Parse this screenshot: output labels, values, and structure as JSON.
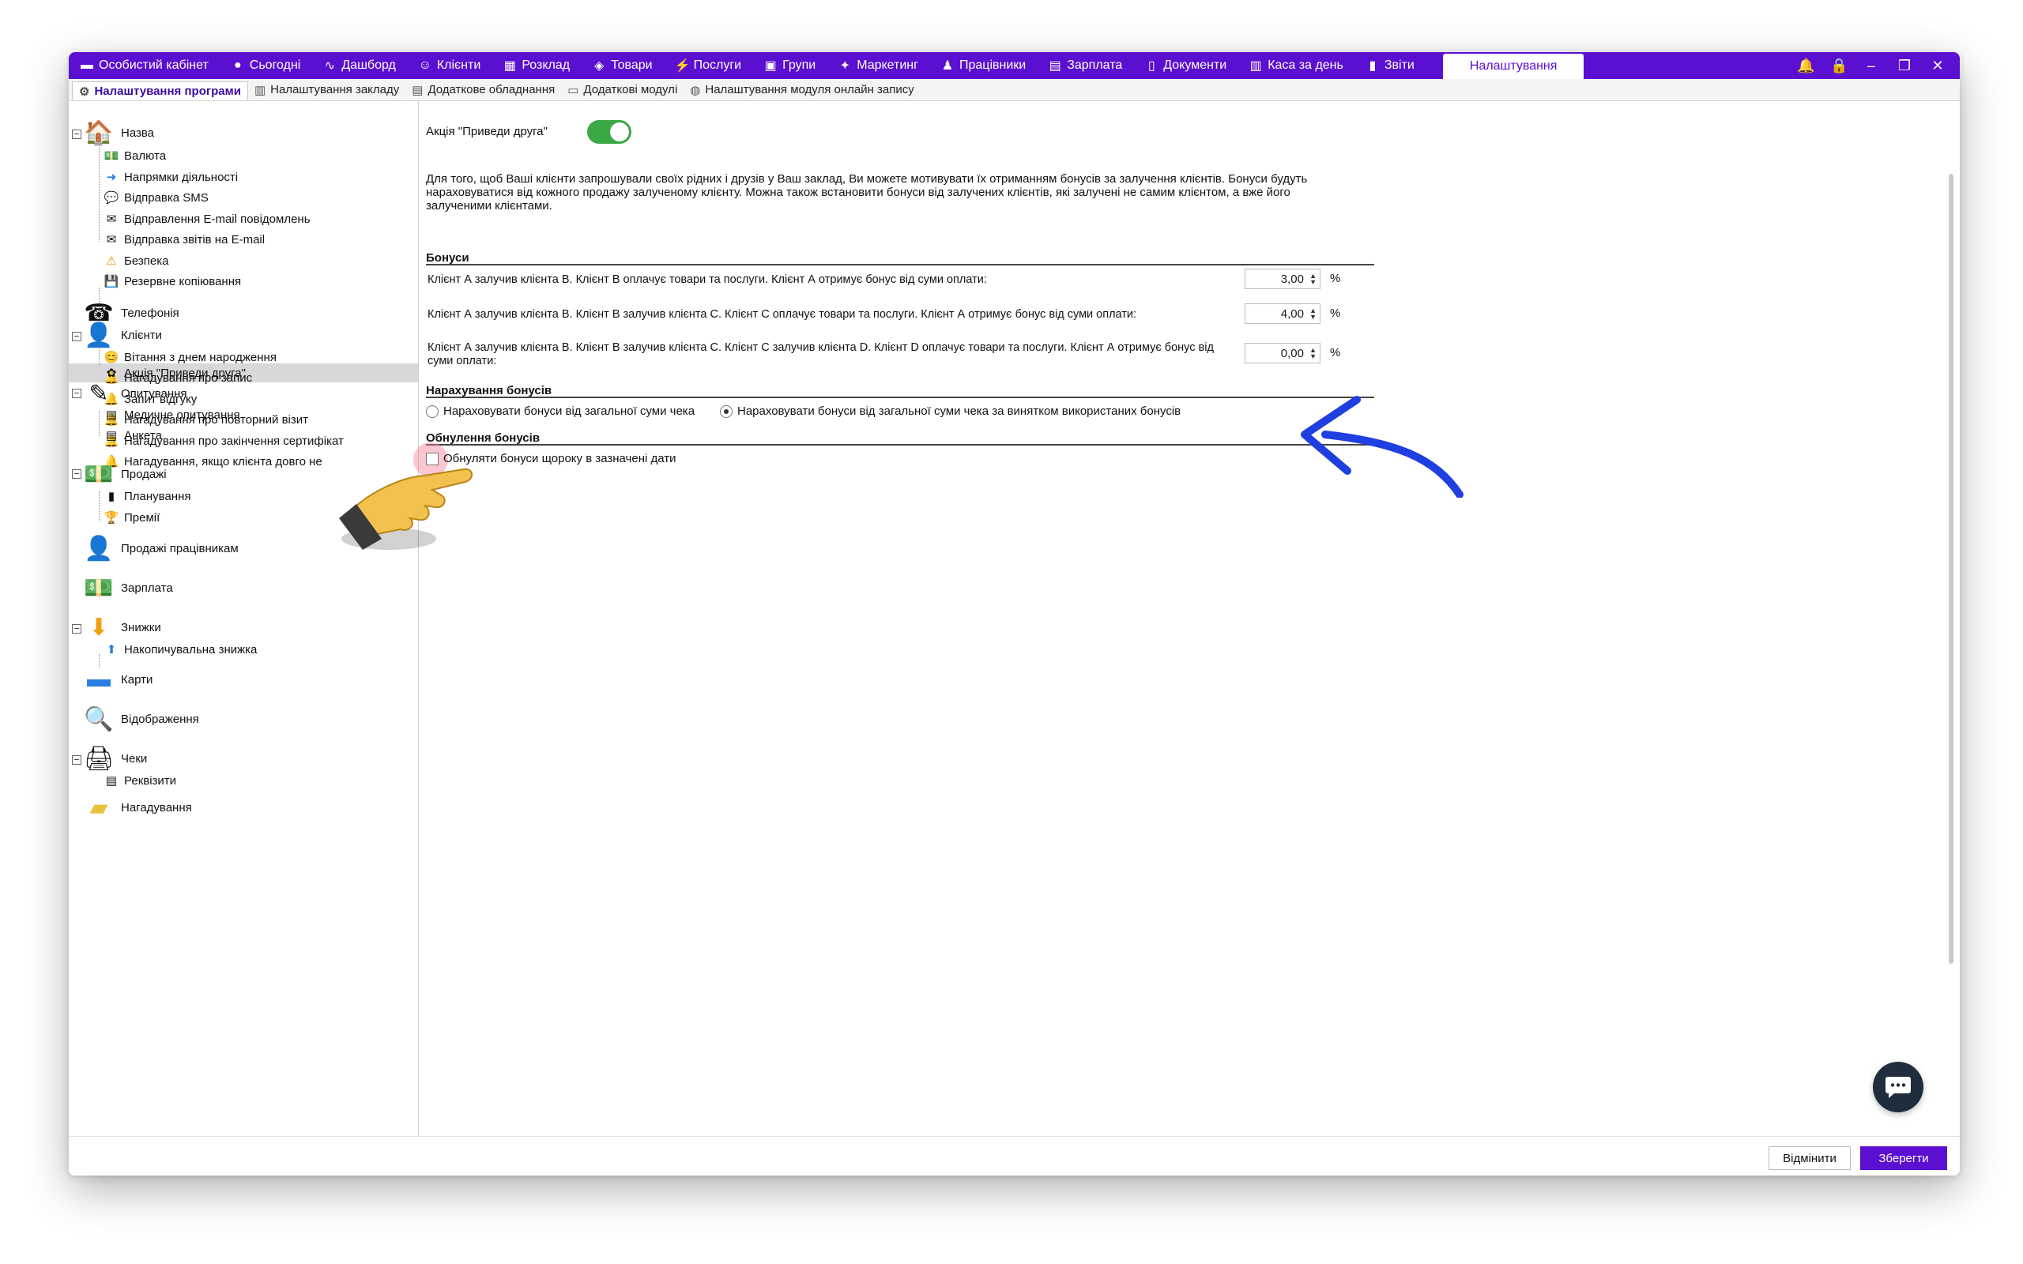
{
  "topnav": [
    {
      "icon": "▬",
      "label": "Особистий кабінет"
    },
    {
      "icon": "●",
      "label": "Сьогодні"
    },
    {
      "icon": "∿",
      "label": "Дашборд"
    },
    {
      "icon": "☺",
      "label": "Клієнти"
    },
    {
      "icon": "▦",
      "label": "Розклад"
    },
    {
      "icon": "◈",
      "label": "Товари"
    },
    {
      "icon": "⚡",
      "label": "Послуги"
    },
    {
      "icon": "▣",
      "label": "Групи"
    },
    {
      "icon": "✦",
      "label": "Маркетинг"
    },
    {
      "icon": "♟",
      "label": "Працівники"
    },
    {
      "icon": "▤",
      "label": "Зарплата"
    },
    {
      "icon": "▯",
      "label": "Документи"
    },
    {
      "icon": "▥",
      "label": "Каса за день"
    },
    {
      "icon": "▮",
      "label": "Звіти"
    },
    {
      "icon": "",
      "label": "Налаштування"
    }
  ],
  "window_controls": [
    "🔔",
    "🔒",
    "–",
    "❐",
    "✕"
  ],
  "tabs": [
    {
      "icon": "⚙",
      "label": "Налаштування програми"
    },
    {
      "icon": "▥",
      "label": "Налаштування закладу"
    },
    {
      "icon": "▤",
      "label": "Додаткове обладнання"
    },
    {
      "icon": "▭",
      "label": "Додаткові модулі"
    },
    {
      "icon": "◍",
      "label": "Налаштування модуля онлайн запису"
    }
  ],
  "tree": {
    "nazva": "Назва",
    "valuta": "Валюта",
    "napryamky": "Напрямки діяльності",
    "sms": "Відправка SMS",
    "email": "Відправлення E-mail повідомлень",
    "reports_email": "Відправка звітів на E-mail",
    "bezpeka": "Безпека",
    "backup": "Резервне копіювання",
    "telefoniya": "Телефонія",
    "klienty": "Клієнти",
    "birthday": "Вітання з днем народження",
    "remind_record": "Нагадування про запис",
    "review": "Запит відгуку",
    "repeat_visit": "Нагадування про повторний візит",
    "cert_end": "Нагадування про закінчення сертифікат",
    "long_absent": "Нагадування, якщо клієнта довго не",
    "refer_friend": "Акція \"Приведи друга\"",
    "opytuvannya": "Опитування",
    "medical": "Медичне опитування",
    "anketa": "Анкета",
    "prodazhi": "Продажі",
    "planning": "Планування",
    "premii": "Премії",
    "staff_sales": "Продажі працівникам",
    "zarplata": "Зарплата",
    "znyzhky": "Знижки",
    "cumulative": "Накопичувальна знижка",
    "karty": "Карти",
    "vidobrazhennya": "Відображення",
    "cheky": "Чеки",
    "rekvizyty": "Реквізити",
    "nahaduvannya": "Нагадування"
  },
  "content": {
    "toggle_label": "Акція \"Приведи друга\"",
    "toggle_on": true,
    "description": "Для того, щоб Ваші клієнти запрошували своїх рідних і друзів у Ваш заклад, Ви можете мотивувати їх отриманням бонусів за залучення клієнтів. Бонуси будуть нараховуватися від кожного продажу залученому клієнту. Можна також встановити бонуси від залучених клієнтів, які залучені не самим клієнтом, а вже його залученими клієнтами.",
    "bonuses_title": "Бонуси",
    "bonus_rows": [
      {
        "text": "Клієнт А залучив клієнта В. Клієнт В оплачує товари та послуги. Клієнт А отримує бонус від суми оплати:",
        "value": "3,00",
        "unit": "%"
      },
      {
        "text": "Клієнт А залучив клієнта В. Клієнт В залучив клієнта С. Клієнт С оплачує товари та послуги. Клієнт А отримує бонус від суми оплати:",
        "value": "4,00",
        "unit": "%"
      },
      {
        "text": "Клієнт А залучив клієнта В. Клієнт В залучив клієнта С. Клієнт С залучив клієнта D. Клієнт D оплачує товари та послуги. Клієнт А отримує бонус від суми оплати:",
        "value": "0,00",
        "unit": "%"
      }
    ],
    "accrual_title": "Нарахування бонусів",
    "radio_total": "Нараховувати бонуси від загальної суми чека",
    "radio_except": "Нараховувати бонуси від загальної суми чека за винятком використаних бонусів",
    "reset_title": "Обнулення бонусів",
    "reset_checkbox": "Обнуляти бонуси щороку в зазначені дати"
  },
  "buttons": {
    "cancel": "Відмінити",
    "save": "Зберегти"
  },
  "colors": {
    "brand": "#5b0fd0",
    "toggle": "#3aa845",
    "arrow": "#1f3fe0"
  }
}
